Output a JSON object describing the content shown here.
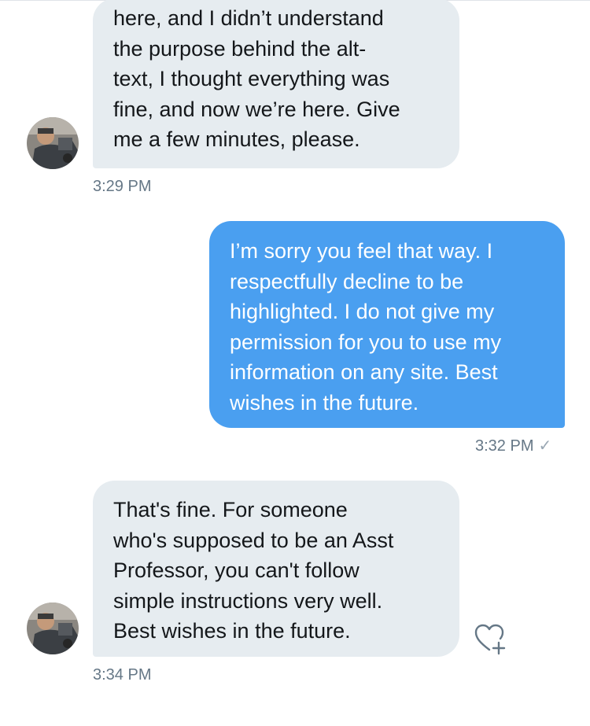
{
  "conversation": {
    "messages": [
      {
        "direction": "received",
        "text": "here, and I didn’t understand\nthe purpose behind the alt-\ntext, I thought everything was\nfine, and now we’re here. Give\nme a few minutes, please.",
        "time": "3:29 PM"
      },
      {
        "direction": "sent",
        "text": "I’m sorry you feel that way. I\nrespectfully decline to be\nhighlighted. I do not give my\npermission for you to use my\ninformation on any site. Best\nwishes in the future.",
        "time": "3:32 PM",
        "status_icon": "checkmark-icon"
      },
      {
        "direction": "received",
        "text": "That's fine. For someone\nwho's supposed to be an Asst\nProfessor, you can't follow\nsimple instructions very well.\nBest wishes in the future.",
        "time": "3:34 PM",
        "reaction_icon": "heart-plus-icon"
      }
    ]
  },
  "colors": {
    "received_bubble": "#e6ecf0",
    "sent_bubble": "#4a9ff0",
    "timestamp": "#657786"
  }
}
